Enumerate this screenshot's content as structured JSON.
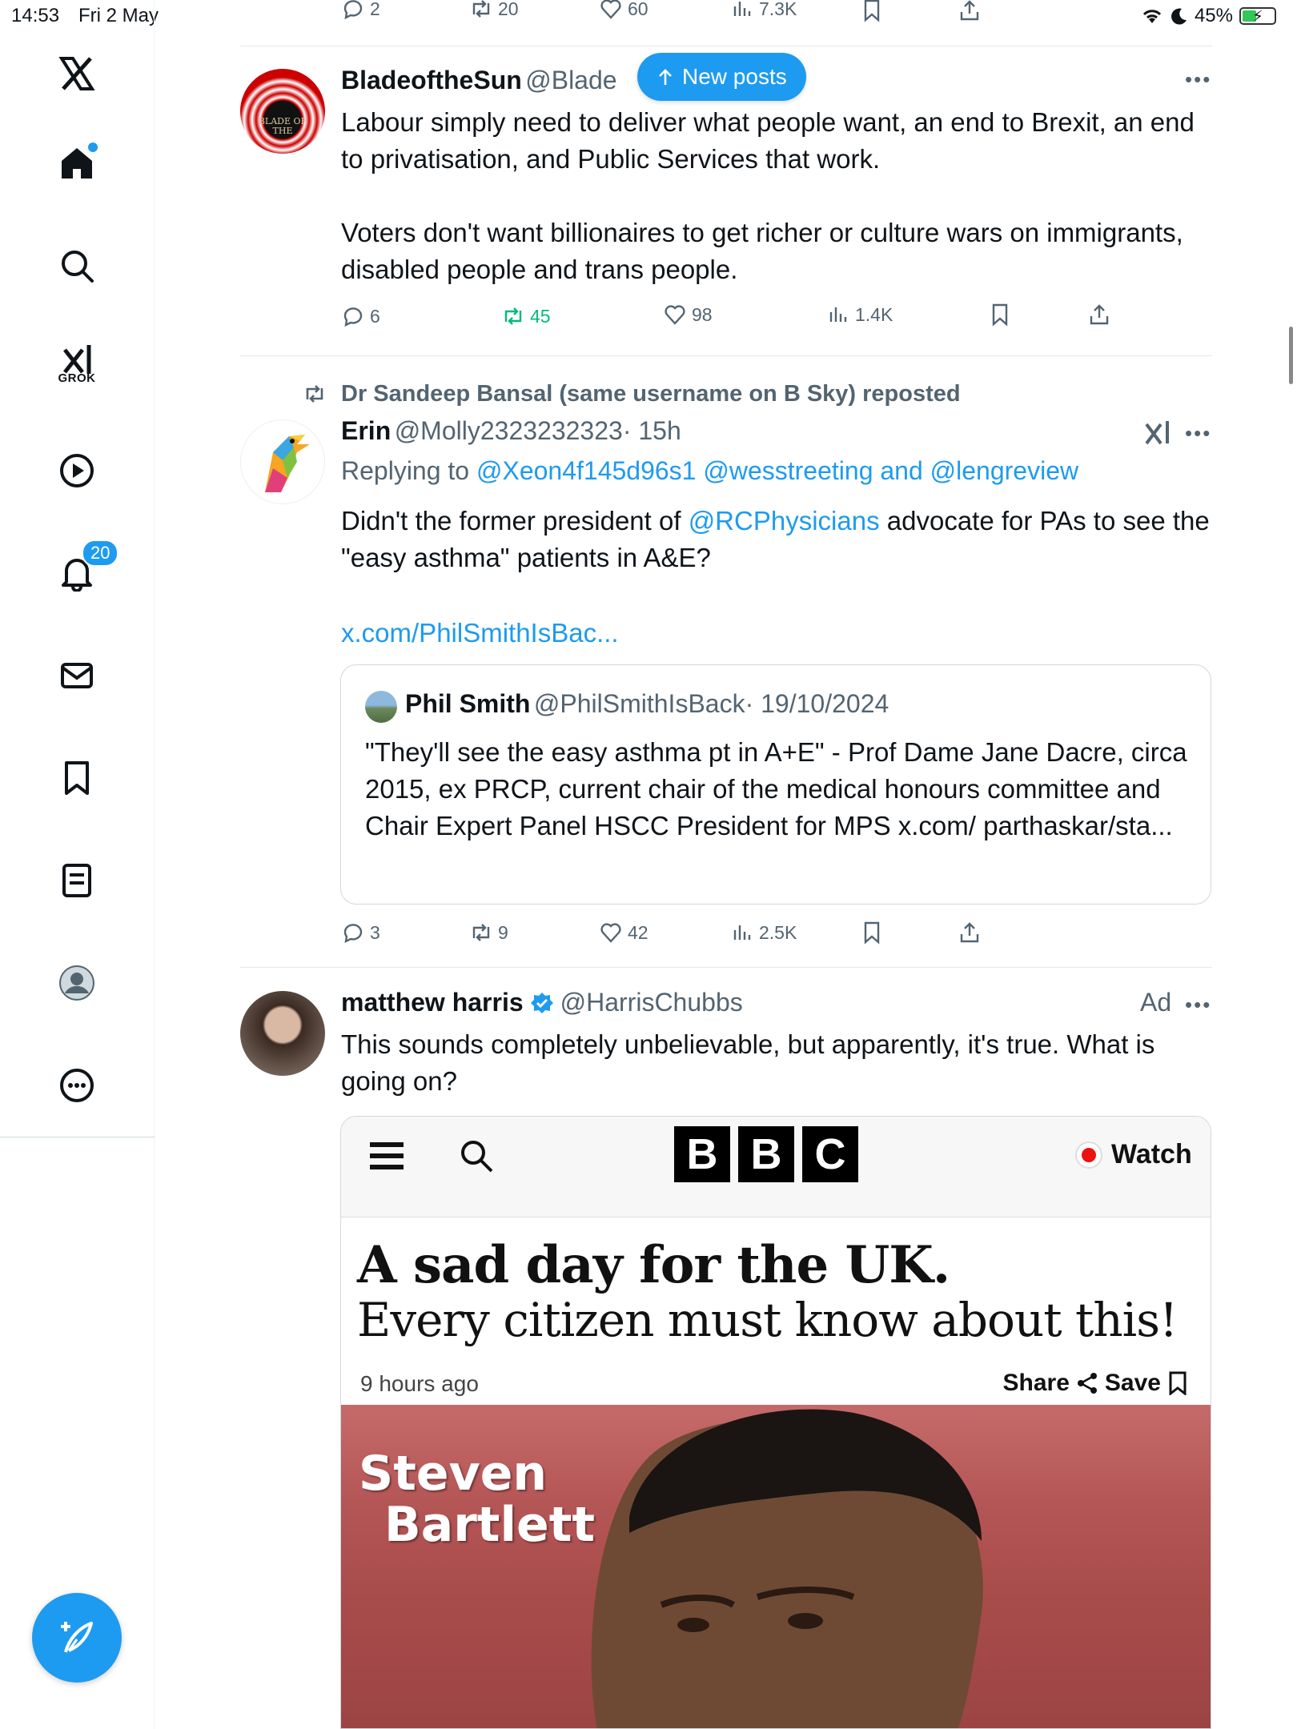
{
  "status_bar": {
    "time": "14:53",
    "date": "Fri 2 May",
    "battery": "45%"
  },
  "sidebar": {
    "notifications_badge": "20",
    "grok_label": "GROK"
  },
  "top_tweet_actions": {
    "replies": "2",
    "reposts": "20",
    "likes": "60",
    "views": "7.3K"
  },
  "new_posts_button": "New posts",
  "tweets": [
    {
      "name": "BladeoftheSun",
      "handle": "@Blade",
      "text": "Labour simply need to deliver what people want, an end to Brexit, an end to privatisation, and Public Services that work.\n\nVoters don't want billionaires to get richer or culture wars on immigrants, disabled people and trans people.",
      "avatar_text": "BLADE OF THE",
      "replies": "6",
      "reposts": "45",
      "likes": "98",
      "views": "1.4K"
    },
    {
      "repost_by": "Dr Sandeep Bansal (same username on B Sky) reposted",
      "name": "Erin",
      "handle": "@Molly2323232323",
      "time": "· 15h",
      "reply_prefix": "Replying to",
      "reply_users": "@Xeon4f145d96s1 @wesstreeting and @lengreview",
      "text_before": "Didn't the former president of ",
      "text_mention": "@RCPhysicians",
      "text_after": " advocate for PAs to see the \"easy asthma\" patients in A&E?",
      "link": "x.com/PhilSmithIsBac...",
      "quote": {
        "name": "Phil Smith",
        "handle": "@PhilSmithIsBack",
        "date": "· 19/10/2024",
        "text": "\"They'll see the easy asthma pt in A+E\" - Prof Dame Jane Dacre, circa 2015, ex PRCP, current chair of the medical honours committee and Chair Expert Panel HSCC President for MPS x.com/ parthaskar/sta..."
      },
      "replies": "3",
      "reposts": "9",
      "likes": "42",
      "views": "2.5K"
    },
    {
      "name": "matthew harris",
      "handle": "@HarrisChubbs",
      "ad_label": "Ad",
      "text": "This sounds completely unbelievable, but apparently, it's true. What is going on?",
      "card": {
        "logo_letters": [
          "B",
          "B",
          "C"
        ],
        "watch": "Watch",
        "headline_1": "A sad day for the UK.",
        "headline_2": "Every citizen must know about this!",
        "time_ago": "9 hours ago",
        "share": "Share",
        "save": "Save",
        "photo_caption_1": "Steven",
        "photo_caption_2": "Bartlett"
      }
    }
  ],
  "colors": {
    "accent": "#1d9bf0",
    "repost_green": "#00ba7c",
    "muted": "#536471"
  }
}
